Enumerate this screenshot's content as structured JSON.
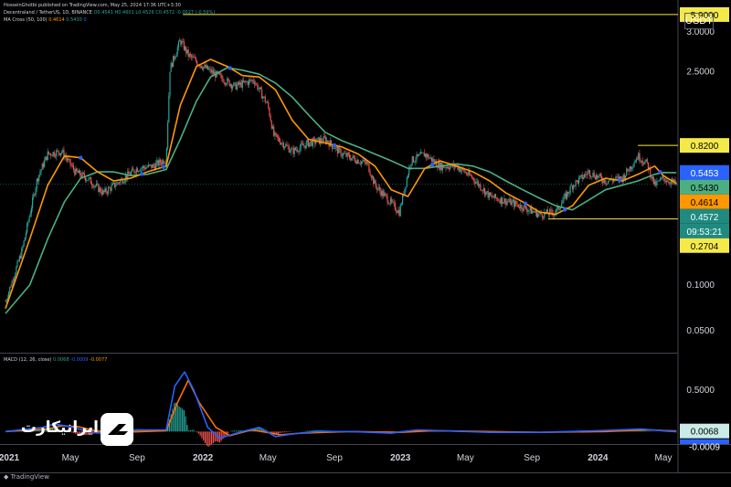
{
  "header": {
    "line1": "HosseinGhotbi published on TradingView.com, May 25, 2024 17:36 UTC+3:30",
    "symbol": "Decentraland / TetherUS, 1D, BINANCE",
    "ohlc": "O0.4541 H0.4601 L0.4526 C0.4572 -0.0027 (-0.59%)",
    "ma_label": "MA Cross (50, 100)",
    "ma_v1": "0.4614",
    "ma_v2": "0.5430",
    "ma_tail": "0",
    "macd_label": "MACD (12, 26, close)",
    "macd_v1": "0.0068",
    "macd_v2": "-0.0009",
    "macd_v3": "-0.0077"
  },
  "currency": "USDT",
  "watermark": {
    "text": "ایرانیکارت"
  },
  "footer": "TradingView",
  "colors": {
    "background": "#000000",
    "fast_ma": "#ff9800",
    "slow_ma": "#4caf82",
    "cross": "#2962ff",
    "level_line": "#f5e94a",
    "candle_up": "#26a69a",
    "candle_down": "#ef5350",
    "macd_line": "#2962ff",
    "signal_line": "#ff6d00"
  },
  "chart_data": [
    {
      "type": "candlestick",
      "title": "Decentraland / TetherUS, 1D, BINANCE",
      "scale": "log",
      "ylim": [
        0.036,
        4.6
      ],
      "y_ticks": [
        {
          "value": 2.5,
          "label": "2.5000"
        },
        {
          "value": 0.5,
          "label": "0.5000"
        },
        {
          "value": 0.1,
          "label": "0.1000"
        },
        {
          "value": 0.05,
          "label": "0.0500"
        }
      ],
      "x_ticks": [
        {
          "date": "2021-01-01",
          "label": "2021"
        },
        {
          "date": "2021-05-01",
          "label": "May"
        },
        {
          "date": "2021-09-01",
          "label": "Sep"
        },
        {
          "date": "2022-01-01",
          "label": "2022"
        },
        {
          "date": "2022-05-01",
          "label": "May"
        },
        {
          "date": "2022-09-01",
          "label": "Sep"
        },
        {
          "date": "2023-01-01",
          "label": "2023"
        },
        {
          "date": "2023-05-01",
          "label": "May"
        },
        {
          "date": "2023-09-01",
          "label": "Sep"
        },
        {
          "date": "2024-01-01",
          "label": "2024"
        },
        {
          "date": "2024-05-01",
          "label": "May"
        }
      ],
      "price_path": [
        [
          "2021-01-01",
          0.078
        ],
        [
          "2021-02-01",
          0.17
        ],
        [
          "2021-03-01",
          0.5
        ],
        [
          "2021-03-20",
          0.72
        ],
        [
          "2021-04-15",
          0.75
        ],
        [
          "2021-05-10",
          0.55
        ],
        [
          "2021-06-01",
          0.5
        ],
        [
          "2021-07-01",
          0.4
        ],
        [
          "2021-08-01",
          0.48
        ],
        [
          "2021-09-01",
          0.58
        ],
        [
          "2021-10-01",
          0.6
        ],
        [
          "2021-10-25",
          0.67
        ],
        [
          "2021-11-01",
          2.6
        ],
        [
          "2021-11-20",
          4.0
        ],
        [
          "2021-12-05",
          3.2
        ],
        [
          "2022-01-01",
          2.7
        ],
        [
          "2022-02-01",
          2.3
        ],
        [
          "2022-03-01",
          2.0
        ],
        [
          "2022-04-05",
          2.2
        ],
        [
          "2022-05-01",
          1.5
        ],
        [
          "2022-05-12",
          0.95
        ],
        [
          "2022-06-15",
          0.75
        ],
        [
          "2022-07-15",
          0.85
        ],
        [
          "2022-08-15",
          0.9
        ],
        [
          "2022-09-15",
          0.72
        ],
        [
          "2022-11-01",
          0.62
        ],
        [
          "2022-11-15",
          0.45
        ],
        [
          "2022-12-30",
          0.3
        ],
        [
          "2023-01-20",
          0.65
        ],
        [
          "2023-02-15",
          0.72
        ],
        [
          "2023-03-15",
          0.6
        ],
        [
          "2023-04-15",
          0.6
        ],
        [
          "2023-05-15",
          0.5
        ],
        [
          "2023-06-15",
          0.38
        ],
        [
          "2023-08-01",
          0.34
        ],
        [
          "2023-09-15",
          0.29
        ],
        [
          "2023-10-15",
          0.3
        ],
        [
          "2023-11-15",
          0.45
        ],
        [
          "2023-12-15",
          0.55
        ],
        [
          "2024-01-15",
          0.48
        ],
        [
          "2024-02-15",
          0.5
        ],
        [
          "2024-03-15",
          0.7
        ],
        [
          "2024-04-01",
          0.62
        ],
        [
          "2024-04-15",
          0.45
        ],
        [
          "2024-05-01",
          0.5
        ],
        [
          "2024-05-25",
          0.4572
        ]
      ],
      "series": [
        {
          "name": "MA 50",
          "values": [
            [
              "2021-01-01",
              0.07
            ],
            [
              "2021-02-15",
              0.2
            ],
            [
              "2021-03-20",
              0.45
            ],
            [
              "2021-04-20",
              0.7
            ],
            [
              "2021-05-20",
              0.68
            ],
            [
              "2021-06-20",
              0.55
            ],
            [
              "2021-07-20",
              0.48
            ],
            [
              "2021-08-20",
              0.5
            ],
            [
              "2021-09-20",
              0.55
            ],
            [
              "2021-10-25",
              0.6
            ],
            [
              "2021-11-20",
              1.5
            ],
            [
              "2021-12-20",
              2.7
            ],
            [
              "2022-01-15",
              3.0
            ],
            [
              "2022-02-15",
              2.7
            ],
            [
              "2022-03-15",
              2.35
            ],
            [
              "2022-04-15",
              2.3
            ],
            [
              "2022-05-15",
              1.9
            ],
            [
              "2022-06-15",
              1.2
            ],
            [
              "2022-07-15",
              0.9
            ],
            [
              "2022-08-15",
              0.85
            ],
            [
              "2022-09-15",
              0.8
            ],
            [
              "2022-10-15",
              0.72
            ],
            [
              "2022-11-15",
              0.6
            ],
            [
              "2022-12-15",
              0.42
            ],
            [
              "2023-01-15",
              0.38
            ],
            [
              "2023-02-15",
              0.58
            ],
            [
              "2023-03-15",
              0.65
            ],
            [
              "2023-04-15",
              0.6
            ],
            [
              "2023-05-15",
              0.55
            ],
            [
              "2023-06-15",
              0.48
            ],
            [
              "2023-07-15",
              0.4
            ],
            [
              "2023-08-15",
              0.35
            ],
            [
              "2023-09-15",
              0.3
            ],
            [
              "2023-10-15",
              0.29
            ],
            [
              "2023-11-15",
              0.33
            ],
            [
              "2023-12-15",
              0.45
            ],
            [
              "2024-01-15",
              0.5
            ],
            [
              "2024-02-15",
              0.48
            ],
            [
              "2024-03-15",
              0.53
            ],
            [
              "2024-04-15",
              0.6
            ],
            [
              "2024-05-01",
              0.52
            ],
            [
              "2024-05-25",
              0.4614
            ]
          ]
        },
        {
          "name": "MA 100",
          "values": [
            [
              "2021-01-01",
              0.065
            ],
            [
              "2021-02-15",
              0.1
            ],
            [
              "2021-03-20",
              0.2
            ],
            [
              "2021-04-20",
              0.35
            ],
            [
              "2021-05-20",
              0.5
            ],
            [
              "2021-06-20",
              0.55
            ],
            [
              "2021-07-20",
              0.55
            ],
            [
              "2021-08-20",
              0.52
            ],
            [
              "2021-09-20",
              0.53
            ],
            [
              "2021-10-25",
              0.57
            ],
            [
              "2021-11-20",
              0.9
            ],
            [
              "2021-12-20",
              1.6
            ],
            [
              "2022-01-15",
              2.3
            ],
            [
              "2022-02-15",
              2.65
            ],
            [
              "2022-03-15",
              2.55
            ],
            [
              "2022-04-15",
              2.4
            ],
            [
              "2022-05-15",
              2.1
            ],
            [
              "2022-06-15",
              1.7
            ],
            [
              "2022-07-15",
              1.3
            ],
            [
              "2022-08-15",
              1.0
            ],
            [
              "2022-09-15",
              0.88
            ],
            [
              "2022-10-15",
              0.8
            ],
            [
              "2022-11-15",
              0.72
            ],
            [
              "2022-12-15",
              0.65
            ],
            [
              "2023-01-15",
              0.58
            ],
            [
              "2023-02-15",
              0.58
            ],
            [
              "2023-03-15",
              0.6
            ],
            [
              "2023-04-15",
              0.62
            ],
            [
              "2023-05-15",
              0.6
            ],
            [
              "2023-06-15",
              0.55
            ],
            [
              "2023-07-15",
              0.48
            ],
            [
              "2023-08-15",
              0.42
            ],
            [
              "2023-09-15",
              0.37
            ],
            [
              "2023-10-15",
              0.33
            ],
            [
              "2023-11-15",
              0.31
            ],
            [
              "2023-12-15",
              0.36
            ],
            [
              "2024-01-15",
              0.42
            ],
            [
              "2024-02-15",
              0.45
            ],
            [
              "2024-03-15",
              0.48
            ],
            [
              "2024-04-15",
              0.53
            ],
            [
              "2024-05-01",
              0.545
            ],
            [
              "2024-05-25",
              0.543
            ]
          ]
        }
      ],
      "level_lines": [
        {
          "from": "2021-11-25",
          "to": "2024-05-25",
          "value": 5.9
        },
        {
          "from": "2024-03-15",
          "to": "2024-05-25",
          "value": 0.82
        },
        {
          "from": "2023-10-01",
          "to": "2024-05-25",
          "value": 0.2704
        }
      ],
      "price_labels": [
        {
          "label": "5.9000",
          "value": 5.9,
          "bg": "#f5e94a",
          "fg": "#000000"
        },
        {
          "label": "0.8200",
          "value": 0.82,
          "bg": "#f5e94a",
          "fg": "#000000"
        },
        {
          "label": "0.5453",
          "value": 0.5453,
          "bg": "#2962ff",
          "fg": "#ffffff"
        },
        {
          "label": "0.5430",
          "value": 0.543,
          "bg": "#4caf82",
          "fg": "#000000"
        },
        {
          "label": "0.4614",
          "value": 0.4614,
          "bg": "#ff9800",
          "fg": "#000000"
        },
        {
          "label": "0.4572",
          "value": 0.4572,
          "bg": "#1f8a80",
          "fg": "#ffffff"
        },
        {
          "label": "09:53:21",
          "value": 0.4572,
          "bg": "#1f8a80",
          "fg": "#ffffff"
        },
        {
          "label": "0.2704",
          "value": 0.2704,
          "bg": "#f5e94a",
          "fg": "#000000"
        }
      ],
      "crosses": [
        "2021-05-20",
        "2021-09-10",
        "2021-10-20",
        "2022-02-20",
        "2022-09-01",
        "2023-03-01",
        "2023-08-20",
        "2023-11-01",
        "2024-02-10",
        "2024-04-25"
      ]
    },
    {
      "type": "line",
      "title": "MACD (12, 26, close)",
      "ylim": [
        -0.14,
        0.82
      ],
      "y_ticks": [
        {
          "value": 0.5,
          "label": "0.5000"
        }
      ],
      "series": [
        {
          "name": "MACD",
          "values": [
            [
              "2021-01-01",
              0.0
            ],
            [
              "2021-03-10",
              0.05
            ],
            [
              "2021-04-01",
              0.09
            ],
            [
              "2021-05-01",
              0.06
            ],
            [
              "2021-06-01",
              0.0
            ],
            [
              "2021-07-01",
              -0.02
            ],
            [
              "2021-09-01",
              0.02
            ],
            [
              "2021-10-25",
              0.02
            ],
            [
              "2021-11-10",
              0.55
            ],
            [
              "2021-11-28",
              0.72
            ],
            [
              "2021-12-15",
              0.5
            ],
            [
              "2022-01-10",
              0.05
            ],
            [
              "2022-02-01",
              -0.08
            ],
            [
              "2022-03-15",
              0.0
            ],
            [
              "2022-04-15",
              0.05
            ],
            [
              "2022-05-15",
              -0.06
            ],
            [
              "2022-06-15",
              -0.03
            ],
            [
              "2022-08-01",
              0.0
            ],
            [
              "2022-10-01",
              0.0
            ],
            [
              "2022-12-15",
              -0.02
            ],
            [
              "2023-02-01",
              0.02
            ],
            [
              "2023-06-15",
              -0.01
            ],
            [
              "2023-09-15",
              -0.01
            ],
            [
              "2024-01-01",
              0.01
            ],
            [
              "2024-03-20",
              0.03
            ],
            [
              "2024-05-25",
              -0.0009
            ]
          ]
        },
        {
          "name": "Signal",
          "values": [
            [
              "2021-01-01",
              0.0
            ],
            [
              "2021-03-20",
              0.03
            ],
            [
              "2021-04-15",
              0.07
            ],
            [
              "2021-05-15",
              0.06
            ],
            [
              "2021-06-15",
              0.01
            ],
            [
              "2021-08-01",
              -0.01
            ],
            [
              "2021-10-25",
              0.01
            ],
            [
              "2021-11-15",
              0.35
            ],
            [
              "2021-12-05",
              0.62
            ],
            [
              "2021-12-25",
              0.35
            ],
            [
              "2022-01-25",
              0.05
            ],
            [
              "2022-02-20",
              -0.05
            ],
            [
              "2022-04-01",
              0.02
            ],
            [
              "2022-05-25",
              -0.04
            ],
            [
              "2022-07-01",
              -0.02
            ],
            [
              "2022-10-01",
              0.0
            ],
            [
              "2023-01-01",
              -0.01
            ],
            [
              "2023-03-01",
              0.01
            ],
            [
              "2023-09-15",
              -0.01
            ],
            [
              "2024-01-15",
              0.0
            ],
            [
              "2024-04-01",
              0.02
            ],
            [
              "2024-05-25",
              0.0068
            ]
          ]
        }
      ],
      "price_labels": [
        {
          "label": "0.0068",
          "value": 0.0068,
          "bg": "#c9ece6",
          "fg": "#000000"
        },
        {
          "label": "-0.0009",
          "value": -0.0009,
          "bg": "#2962ff",
          "fg": "#ffffff"
        },
        {
          "label": "-0.0077",
          "value": -0.0077,
          "bg": "#ff6d00",
          "fg": "#000000"
        }
      ]
    }
  ]
}
